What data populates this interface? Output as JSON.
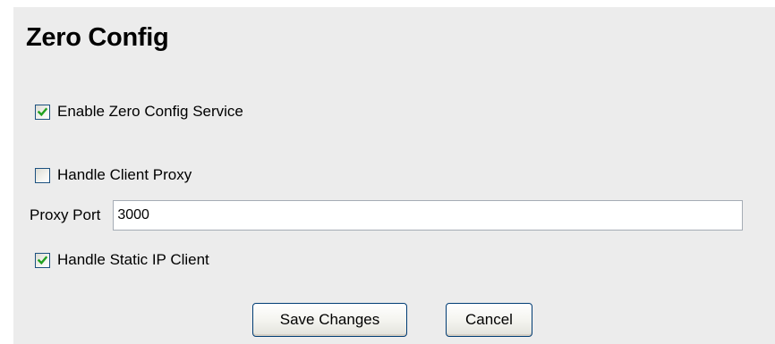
{
  "page": {
    "title": "Zero Config"
  },
  "form": {
    "enable_service": {
      "label": "Enable Zero Config Service",
      "checked": true
    },
    "handle_client_proxy": {
      "label": "Handle Client Proxy",
      "checked": false
    },
    "proxy_port": {
      "label": "Proxy Port",
      "value": "3000"
    },
    "handle_static_ip": {
      "label": "Handle Static IP Client",
      "checked": true
    }
  },
  "buttons": {
    "save_label": "Save Changes",
    "cancel_label": "Cancel"
  },
  "colors": {
    "panel_background": "#ececec",
    "checkmark": "#21a121",
    "checkbox_border": "#1c5180",
    "button_border": "#003c74"
  },
  "icons": {
    "checked": "checkmark-icon"
  }
}
